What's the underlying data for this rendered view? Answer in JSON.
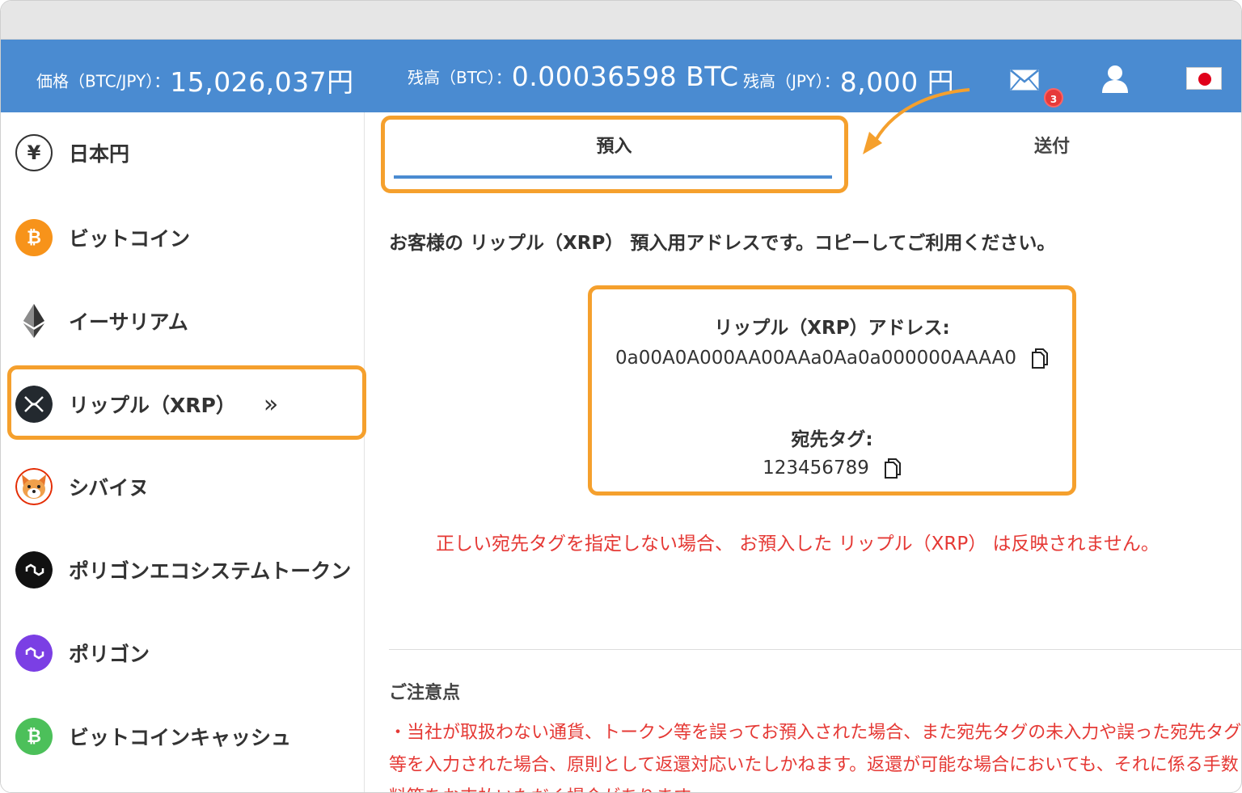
{
  "header": {
    "price_label": "価格（BTC/JPY）：",
    "price_value": "15,026,037円",
    "btc_balance_label": "残高（BTC）：",
    "btc_balance_value": "0.00036598 BTC",
    "jpy_balance_label": "残高（JPY）：",
    "jpy_balance_value": "8,000 円",
    "mail_badge_count": "3",
    "colors": {
      "bar": "#4a8bd1",
      "badge": "#e63a3a"
    }
  },
  "sidebar": {
    "items": [
      {
        "label": "日本円",
        "icon": "yen-icon"
      },
      {
        "label": "ビットコイン",
        "icon": "bitcoin-icon"
      },
      {
        "label": "イーサリアム",
        "icon": "ethereum-icon"
      },
      {
        "label": "リップル（XRP）",
        "icon": "xrp-icon",
        "selected": true,
        "chevron": "»"
      },
      {
        "label": "シバイヌ",
        "icon": "shiba-icon"
      },
      {
        "label": "ポリゴンエコシステムトークン",
        "icon": "pol-icon"
      },
      {
        "label": "ポリゴン",
        "icon": "polygon-icon"
      },
      {
        "label": "ビットコインキャッシュ",
        "icon": "bitcoin-cash-icon"
      }
    ],
    "highlight_color": "#f5a02d"
  },
  "tabs": {
    "deposit": "預入",
    "send": "送付",
    "active": "deposit"
  },
  "main": {
    "intro": "お客様の リップル（XRP） 預入用アドレスです。コピーしてご利用ください。",
    "address_title": "リップル（XRP）アドレス:",
    "address_value": "0a00A0A000AA00AAa0Aa0a000000AAAA0",
    "tag_title": "宛先タグ:",
    "tag_value": "123456789",
    "warning": "正しい宛先タグを指定しない場合、 お預入した リップル（XRP） は反映されません。",
    "notes_title": "ご注意点",
    "notes_body": "・当社が取扱わない通貨、トークン等を誤ってお預入された場合、また宛先タグの未入力や誤った宛先タグ等を入力された場合、原則として返還対応いたしかねます。返還が可能な場合においても、それに係る手数料等をお支払いただく場合があります。"
  }
}
